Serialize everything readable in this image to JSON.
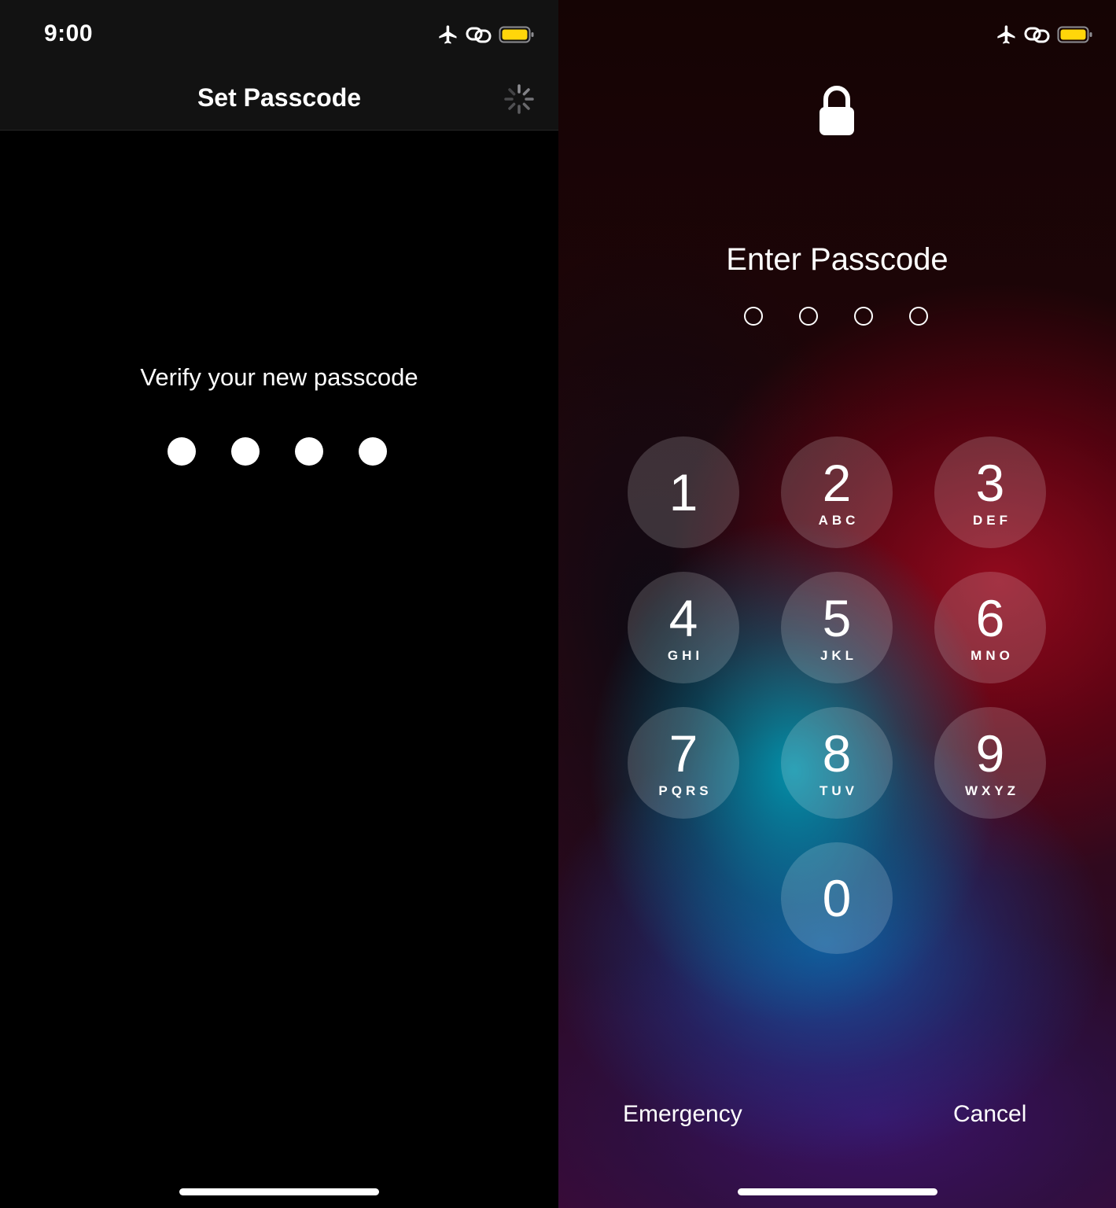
{
  "left_screen": {
    "status": {
      "time": "9:00"
    },
    "nav": {
      "title": "Set Passcode"
    },
    "prompt": "Verify your new passcode",
    "passcode_dots_filled": 4
  },
  "right_screen": {
    "prompt": "Enter Passcode",
    "passcode_dots_empty": 4,
    "keypad": [
      {
        "digit": "1",
        "letters": ""
      },
      {
        "digit": "2",
        "letters": "ABC"
      },
      {
        "digit": "3",
        "letters": "DEF"
      },
      {
        "digit": "4",
        "letters": "GHI"
      },
      {
        "digit": "5",
        "letters": "JKL"
      },
      {
        "digit": "6",
        "letters": "MNO"
      },
      {
        "digit": "7",
        "letters": "PQRS"
      },
      {
        "digit": "8",
        "letters": "TUV"
      },
      {
        "digit": "9",
        "letters": "WXYZ"
      },
      {
        "digit": "0",
        "letters": ""
      }
    ],
    "emergency_label": "Emergency",
    "cancel_label": "Cancel"
  },
  "icons": {
    "airplane": "airplane-icon",
    "link": "link-icon",
    "battery": "battery-icon",
    "spinner": "spinner-icon",
    "lock": "lock-icon"
  },
  "colors": {
    "battery_fill": "#FFD60A",
    "nav_background": "#121212"
  }
}
